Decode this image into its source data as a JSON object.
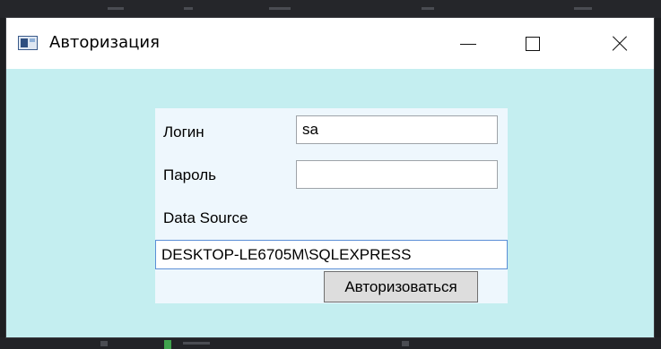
{
  "window": {
    "title": "Авторизация",
    "icon": "app-window-icon",
    "controls": [
      "minimize-icon",
      "maximize-icon",
      "close-icon"
    ]
  },
  "form": {
    "login_label": "Логин",
    "login_value": "sa",
    "password_label": "Пароль",
    "password_value": "",
    "data_source_label": "Data Source",
    "data_source_value": "DESKTOP-LE6705M\\SQLEXPRESS",
    "submit_label": "Авторизоваться"
  },
  "colors": {
    "window_background": "#c4eef0",
    "panel_background": "#eef7fd",
    "focus_border": "#5b8fd6",
    "button_background": "#dddddd"
  }
}
